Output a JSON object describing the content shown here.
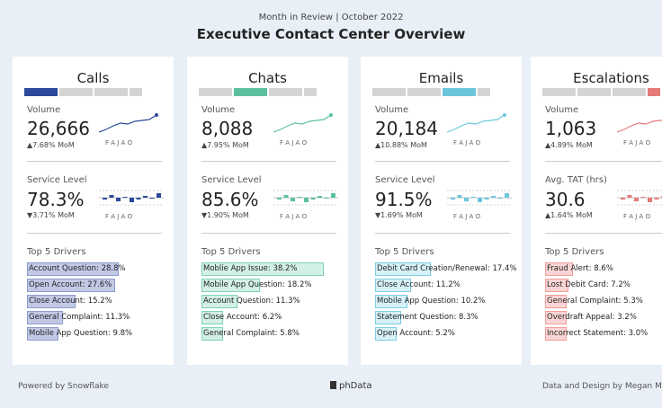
{
  "header": {
    "subtitle": "Month in Review | October 2022",
    "title": "Executive Contact Center Overview"
  },
  "labels": {
    "volume": "Volume",
    "service_level": "Service Level",
    "avg_tat": "Avg. TAT (hrs)",
    "top5": "Top 5 Drivers"
  },
  "colors": {
    "calls": "#2b4a9c",
    "chats": "#5cc0a0",
    "emails": "#6bc6dc",
    "escalations": "#e57a78"
  },
  "cards": [
    {
      "name": "Calls",
      "volume": "26,666",
      "volume_mom": "▲7.68% MoM",
      "sl_label": "Service Level",
      "sl": "78.3%",
      "sl_mom": "▼3.71% MoM",
      "months": "F  A  J  A  O",
      "drivers": [
        {
          "label": "Account Question: 28.8%",
          "value": 28.8
        },
        {
          "label": "Open Account: 27.6%",
          "value": 27.6
        },
        {
          "label": "Close Account: 15.2%",
          "value": 15.2
        },
        {
          "label": "General Complaint: 11.3%",
          "value": 11.3
        },
        {
          "label": "Mobile App Question: 9.8%",
          "value": 9.8
        }
      ]
    },
    {
      "name": "Chats",
      "volume": "8,088",
      "volume_mom": "▲7.95% MoM",
      "sl_label": "Service Level",
      "sl": "85.6%",
      "sl_mom": "▼1.90% MoM",
      "months": "F  A  J  A  O",
      "drivers": [
        {
          "label": "Moblie App Issue: 38.2%",
          "value": 38.2
        },
        {
          "label": "Mobile App Question: 18.2%",
          "value": 18.2
        },
        {
          "label": "Account Question: 11.3%",
          "value": 11.3
        },
        {
          "label": "Close Account: 6.2%",
          "value": 6.2
        },
        {
          "label": "General Complaint: 5.8%",
          "value": 5.8
        }
      ]
    },
    {
      "name": "Emails",
      "volume": "20,184",
      "volume_mom": "▲10.88% MoM",
      "sl_label": "Service Level",
      "sl": "91.5%",
      "sl_mom": "▼1.69% MoM",
      "months": "F  A  J  A  O",
      "drivers": [
        {
          "label": "Debit Card Creation/Renewal: 17.4%",
          "value": 17.4
        },
        {
          "label": "Close Account: 11.2%",
          "value": 11.2
        },
        {
          "label": "Mobile App Question: 10.2%",
          "value": 10.2
        },
        {
          "label": "Statement Question: 8.3%",
          "value": 8.3
        },
        {
          "label": "Open Account: 5.2%",
          "value": 5.2
        }
      ]
    },
    {
      "name": "Escalations",
      "volume": "1,063",
      "volume_mom": "▲4.89% MoM",
      "sl_label": "Avg. TAT (hrs)",
      "sl": "30.6",
      "sl_mom": "▲1.64% MoM",
      "months": "F  A  J  A  O",
      "drivers": [
        {
          "label": "Fraud Alert: 8.6%",
          "value": 8.6
        },
        {
          "label": "Lost Debit Card: 7.2%",
          "value": 7.2
        },
        {
          "label": "General Complaint: 5.3%",
          "value": 5.3
        },
        {
          "label": "Overdraft Appeal: 3.2%",
          "value": 3.2
        },
        {
          "label": "Incorrect Statement: 3.0%",
          "value": 3.0
        }
      ]
    }
  ],
  "footer": {
    "left": "Powered by Snowflake",
    "center": "phData",
    "right": "Data and Design by Megan M"
  }
}
